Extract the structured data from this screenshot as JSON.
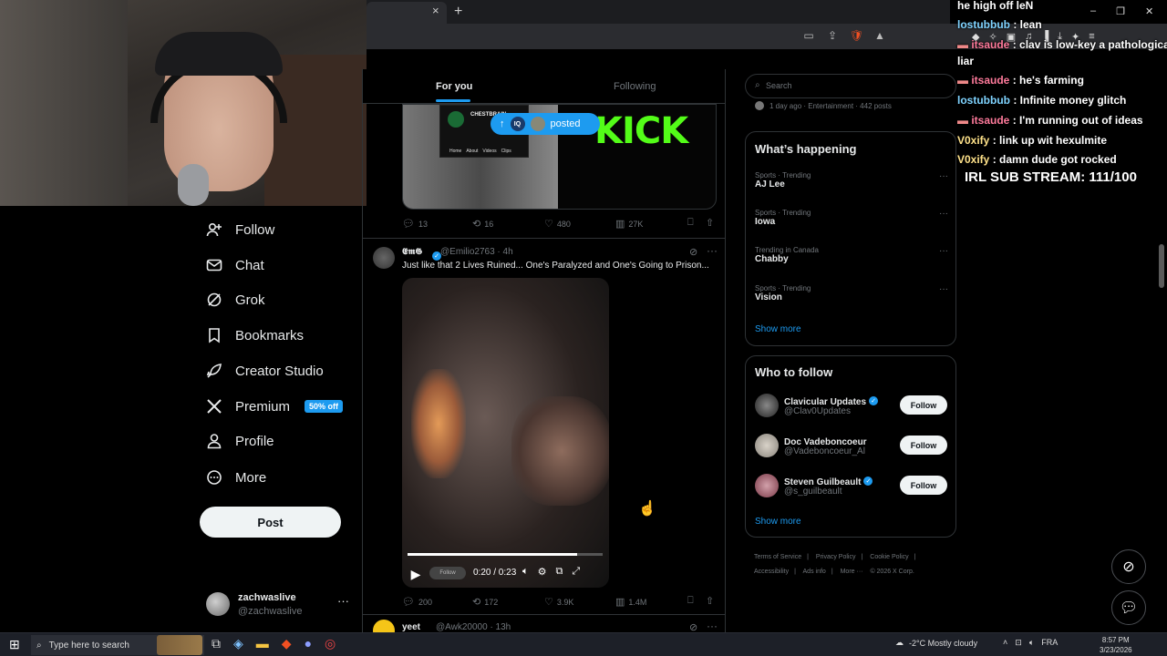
{
  "browser": {
    "new_tab": "+",
    "close_tab": "×",
    "window_controls": [
      "–",
      "❐",
      "✕"
    ]
  },
  "sidebar": {
    "items": [
      {
        "label": "Follow",
        "icon": "add-person-icon"
      },
      {
        "label": "Chat",
        "icon": "mail-icon"
      },
      {
        "label": "Grok",
        "icon": "grok-icon"
      },
      {
        "label": "Bookmarks",
        "icon": "bookmark-icon"
      },
      {
        "label": "Creator Studio",
        "icon": "rocket-icon"
      },
      {
        "label": "Premium",
        "icon": "x-logo-icon",
        "badge": "50% off"
      },
      {
        "label": "Profile",
        "icon": "person-icon"
      },
      {
        "label": "More",
        "icon": "more-circle-icon"
      }
    ],
    "post_label": "Post",
    "account": {
      "name": "zachwaslive",
      "handle": "@zachwaslive"
    }
  },
  "timeline": {
    "tabs": {
      "for_you": "For you",
      "following": "Following"
    },
    "posted_pill": {
      "label": "posted",
      "badge": "IQ"
    },
    "tweet1": {
      "card_brand": "CHESTBRAIN",
      "card_tabs": [
        "Home",
        "About",
        "Videos",
        "Clips"
      ],
      "media_logo": "KICK",
      "replies": "13",
      "reposts": "16",
      "likes": "480",
      "views": "27K"
    },
    "tweet2": {
      "name": "𝕰𝖒𝕲",
      "handle": "@Emilio2763 · 4h",
      "text": "Just like that 2 Lives Ruined... One's Paralyzed and One's Going to Prison...",
      "video_follow": "Follow",
      "video_time": "0:20 / 0:23",
      "video_progress": 0.87,
      "replies": "200",
      "reposts": "172",
      "likes": "3.9K",
      "views": "1.4M"
    },
    "tweet3": {
      "name": "yeet",
      "handle": "@Awk20000 · 13h"
    }
  },
  "right": {
    "search_placeholder": "Search",
    "news_meta": "1 day ago · Entertainment · 442 posts",
    "happening_title": "What’s happening",
    "trends": [
      {
        "meta": "Sports · Trending",
        "name": "AJ Lee"
      },
      {
        "meta": "Sports · Trending",
        "name": "Iowa"
      },
      {
        "meta": "Trending in Canada",
        "name": "Chabby"
      },
      {
        "meta": "Sports · Trending",
        "name": "Vision"
      }
    ],
    "show_more": "Show more",
    "wtf_title": "Who to follow",
    "follow_label": "Follow",
    "suggestions": [
      {
        "name": "Clavicular Updates",
        "handle": "@Clav0Updates",
        "verified": true
      },
      {
        "name": "Doc Vadeboncoeur",
        "handle": "@Vadeboncoeur_Al",
        "verified": false
      },
      {
        "name": "Steven Guilbeault",
        "handle": "@s_guilbeault",
        "verified": true
      }
    ],
    "footer": [
      "Terms of Service",
      "|",
      "Privacy Policy",
      "|",
      "Cookie Policy",
      "|",
      "Accessibility",
      "|",
      "Ads info",
      "|",
      "More ···",
      "© 2026 X Corp."
    ]
  },
  "chat": [
    {
      "user": "",
      "msg": "he high off leN",
      "color": "white"
    },
    {
      "user": "lostubbub",
      "msg": " : lean",
      "color": "blue"
    },
    {
      "user": "itsaude",
      "msg": " : clav is low-key a pathological",
      "color": "red"
    },
    {
      "user": "",
      "msg": "liar",
      "color": "white"
    },
    {
      "user": "itsaude",
      "msg": " : he's farming",
      "color": "red"
    },
    {
      "user": "lostubbub",
      "msg": " : Infinite money glitch",
      "color": "blue"
    },
    {
      "user": "itsaude",
      "msg": " : I'm running out of ideas",
      "color": "red"
    },
    {
      "user": "V0xify",
      "msg": " : link up wit hexulmite",
      "color": "yellow"
    },
    {
      "user": "V0xify",
      "msg": " : damn dude got rocked",
      "color": "yellow"
    }
  ],
  "sub_goal": "IRL SUB STREAM: 111/100",
  "taskbar": {
    "search_placeholder": "Type here to search",
    "weather": "-2°C  Mostly cloudy",
    "lang": "FRA",
    "time": "8:57 PM",
    "date": "3/23/2026"
  }
}
